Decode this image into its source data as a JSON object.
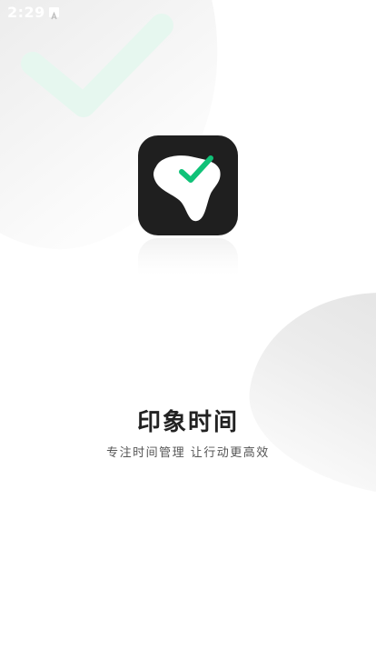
{
  "status_bar": {
    "time": "2:29",
    "notification_icon": "a-letter-notification-icon"
  },
  "splash": {
    "app_icon": "hand-with-green-check-icon",
    "background_decoration": "check-mark-icon",
    "title": "印象时间",
    "slogan": "专注时间管理 让行动更高效"
  },
  "colors": {
    "accent_green": "#10c278",
    "icon_background": "#1f1f1f",
    "title_text": "#222222",
    "slogan_text": "#555555",
    "background_check": "#e6f7ef"
  }
}
